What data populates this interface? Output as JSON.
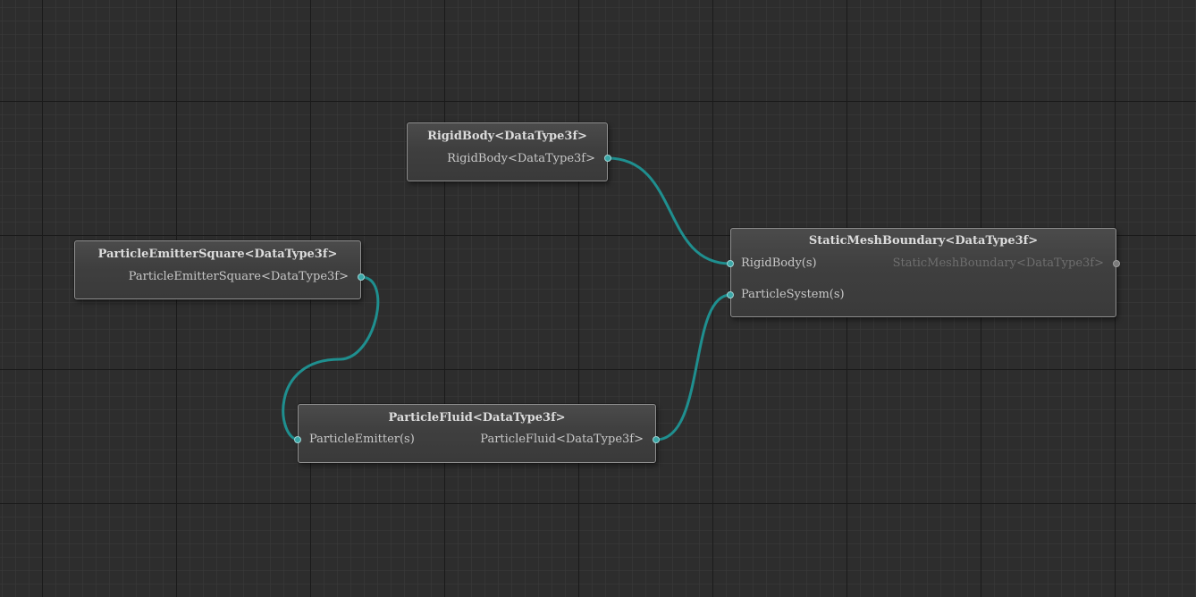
{
  "colors": {
    "canvas": "#2d2d2d",
    "connection": "#1f8f8f",
    "port": "#3aa6a6",
    "port_inactive": "#7a7a7a"
  },
  "nodes": {
    "rigid_body": {
      "title": "RigidBody<DataType3f>",
      "output": "RigidBody<DataType3f>"
    },
    "emitter": {
      "title": "ParticleEmitterSquare<DataType3f>",
      "output": "ParticleEmitterSquare<DataType3f>"
    },
    "fluid": {
      "title": "ParticleFluid<DataType3f>",
      "input": "ParticleEmitter(s)",
      "output": "ParticleFluid<DataType3f>"
    },
    "boundary": {
      "title": "StaticMeshBoundary<DataType3f>",
      "input_rigid": "RigidBody(s)",
      "input_particles": "ParticleSystem(s)",
      "output": "StaticMeshBoundary<DataType3f>"
    }
  },
  "connections": [
    {
      "from": "rigid_body.output",
      "to": "boundary.input_rigid"
    },
    {
      "from": "emitter.output",
      "to": "fluid.input"
    },
    {
      "from": "fluid.output",
      "to": "boundary.input_particles"
    }
  ]
}
